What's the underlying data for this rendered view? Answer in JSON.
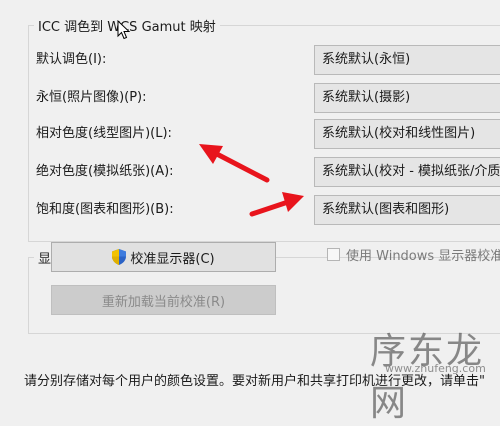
{
  "gamut_group": {
    "title": "ICC 调色到 WCS Gamut 映射",
    "rows": [
      {
        "label": "默认调色(I):",
        "value": "系统默认(永恒)"
      },
      {
        "label": "永恒(照片图像)(P):",
        "value": "系统默认(摄影)"
      },
      {
        "label": "相对色度(线型图片)(L):",
        "value": "系统默认(校对和线性图片)"
      },
      {
        "label": "绝对色度(模拟纸张)(A):",
        "value": "系统默认(校对 - 模拟纸张/介质)"
      },
      {
        "label": "饱和度(图表和图形)(B):",
        "value": "系统默认(图表和图形)"
      }
    ]
  },
  "calibration_group": {
    "title": "显示器校准",
    "calibrate_button": "校准显示器(C)",
    "reload_button": "重新加载当前校准(R)",
    "use_windows_checkbox": "使用 Windows 显示器校准"
  },
  "footer_text": "请分别存储对每个用户的颜色设置。要对新用户和共享打印机进行更改，请单击\"",
  "watermark": {
    "main": "序东龙网",
    "sub": "www.zhufeng.com"
  },
  "colors": {
    "arrow": "#e8141c",
    "shield_blue": "#2b63c6",
    "shield_yellow": "#f2c200"
  }
}
